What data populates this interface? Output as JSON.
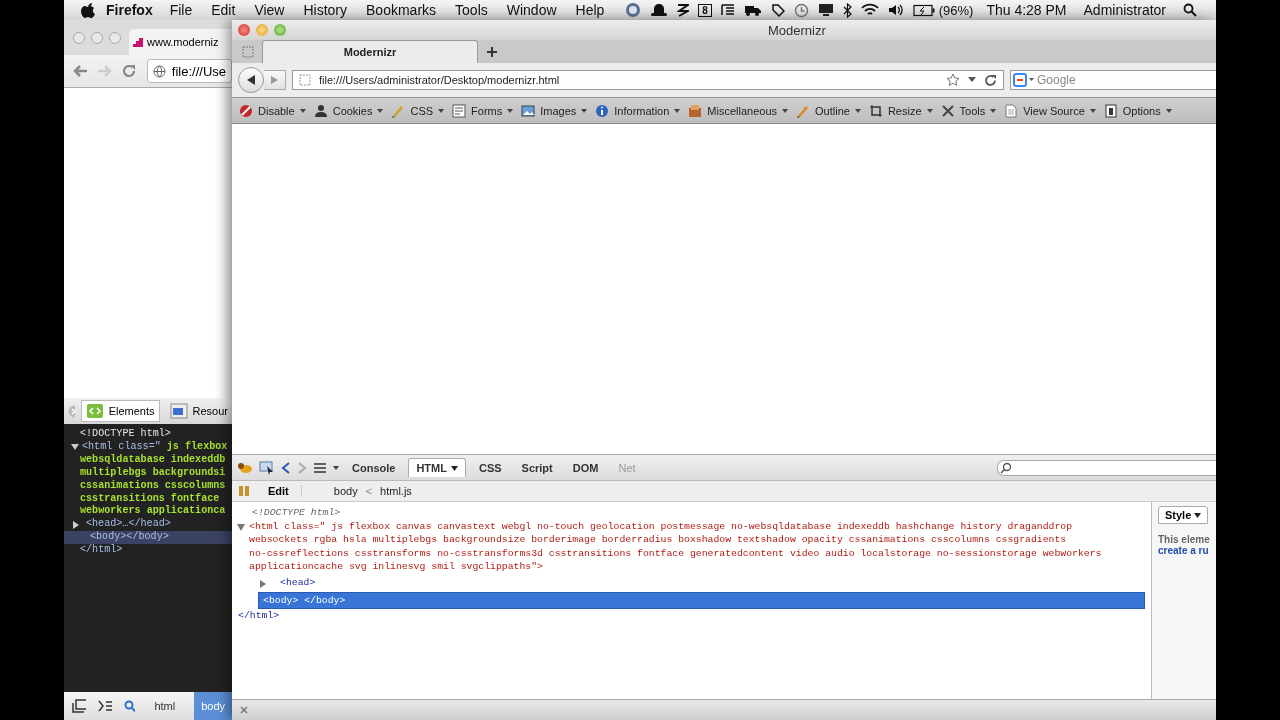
{
  "menu_bar": {
    "app": "Firefox",
    "items": [
      "File",
      "Edit",
      "View",
      "History",
      "Bookmarks",
      "Tools",
      "Window",
      "Help"
    ],
    "calendar_day": "8",
    "battery": "(96%)",
    "clock": "Thu 4:28 PM",
    "user": "Administrator"
  },
  "chrome_window": {
    "tab_title": "www.moderniz",
    "url": "file:///Use",
    "devtools": {
      "tabs": [
        {
          "label": "Elements",
          "selected": true
        },
        {
          "label": "Resour",
          "selected": false
        }
      ],
      "tree": [
        {
          "kind": "doctype",
          "text": "<!DOCTYPE html>",
          "selected": false
        },
        {
          "kind": "element",
          "tag_open": "<html class=\" ",
          "value_lines": [
            "js flexbox",
            "websqldatabase indexeddb",
            "multiplebgs backgroundsi",
            "cssanimations csscolumns",
            "csstransitions fontface",
            "webworkers applicationca"
          ],
          "expanded": true,
          "selected": false,
          "closing": "</html>",
          "children": [
            {
              "kind": "toggle",
              "text": "<head>…</head>",
              "expanded": false,
              "selected": false
            },
            {
              "kind": "leaf",
              "text": "<body></body>",
              "selected": true
            }
          ]
        }
      ],
      "breadcrumbs": [
        {
          "label": "html",
          "selected": false
        },
        {
          "label": "body",
          "selected": true
        }
      ]
    }
  },
  "firefox_window": {
    "title": "Modernizr",
    "tabs": [
      {
        "label": "Modernizr",
        "selected": true
      }
    ],
    "url": "file:///Users/administrator/Desktop/modernizr.html",
    "search": {
      "placeholder": "Google"
    },
    "dev_toolbar": [
      "Disable",
      "Cookies",
      "CSS",
      "Forms",
      "Images",
      "Information",
      "Miscellaneous",
      "Outline",
      "Resize",
      "Tools",
      "View Source",
      "Options"
    ],
    "firebug": {
      "panels": [
        {
          "label": "Console",
          "selected": false,
          "disabled": false
        },
        {
          "label": "HTML",
          "selected": true,
          "disabled": false
        },
        {
          "label": "CSS",
          "selected": false,
          "disabled": false
        },
        {
          "label": "Script",
          "selected": false,
          "disabled": false
        },
        {
          "label": "DOM",
          "selected": false,
          "disabled": false
        },
        {
          "label": "Net",
          "selected": false,
          "disabled": true
        }
      ],
      "edit": "Edit",
      "path": [
        "body",
        "<",
        "html.js"
      ],
      "tree": [
        {
          "kind": "doctype",
          "text": "<!DOCTYPE html>",
          "selected": false
        },
        {
          "kind": "element",
          "tag_open": "<html class=\" ",
          "value_lines": [
            "js flexbox canvas canvastext webgl no-touch geolocation postmessage no-websqldatabase indexeddb hashchange history draganddrop",
            "websockets rgba hsla multiplebgs backgroundsize borderimage borderradius boxshadow textshadow opacity cssanimations csscolumns cssgradients",
            "no-cssreflections csstransforms no-csstransforms3d csstransitions fontface generatedcontent video audio localstorage no-sessionstorage webworkers",
            "applicationcache svg inlinesvg smil svgclippaths\">"
          ],
          "expanded": true,
          "selected": false,
          "closing": "</html>",
          "children": [
            {
              "kind": "toggle",
              "text": "<head>",
              "expanded": false,
              "selected": false
            },
            {
              "kind": "leaf",
              "text": "<body> </body>",
              "selected": true
            }
          ]
        }
      ],
      "side_tab": "Style",
      "side_text": "This eleme",
      "side_link": "create a ru"
    }
  }
}
